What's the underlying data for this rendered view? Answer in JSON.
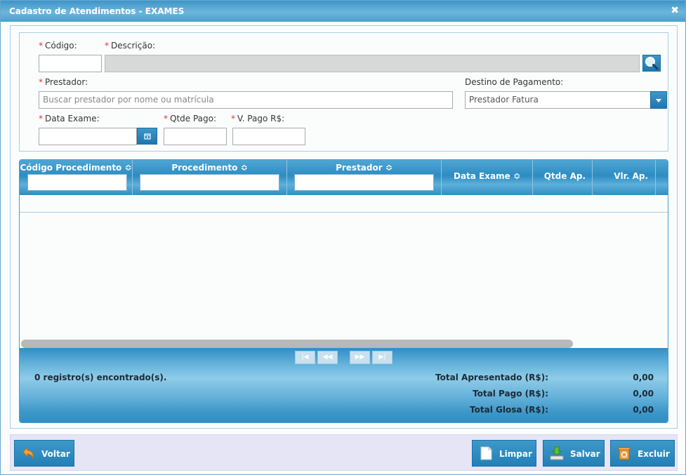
{
  "window": {
    "title": "Cadastro de Atendimentos - EXAMES",
    "close_glyph": "✖"
  },
  "form": {
    "codigo": {
      "label": "Código:",
      "value": ""
    },
    "descricao": {
      "label": "Descrição:",
      "value": ""
    },
    "prestador": {
      "label": "Prestador:",
      "placeholder": "Buscar prestador por nome ou matrícula"
    },
    "destino": {
      "label": "Destino de Pagamento:",
      "selected": "Prestador Fatura"
    },
    "data_exame": {
      "label": "Data Exame:",
      "value": ""
    },
    "qtde_pago": {
      "label": "Qtde Pago:",
      "value": ""
    },
    "v_pago": {
      "label": "V. Pago R$:",
      "value": ""
    },
    "required_mark": "*"
  },
  "grid": {
    "columns": [
      {
        "label": "Código Procedimento",
        "sort_glyph": "≎",
        "filter": true
      },
      {
        "label": "Procedimento",
        "sort_glyph": "≎",
        "filter": true
      },
      {
        "label": "Prestador",
        "sort_glyph": "≎",
        "filter": true
      },
      {
        "label": "Data Exame",
        "sort_glyph": "≎",
        "filter": false
      },
      {
        "label": "Qtde Ap.",
        "sort_glyph": "",
        "filter": false
      },
      {
        "label": "Vlr. Ap.",
        "sort_glyph": "",
        "filter": false
      }
    ],
    "rows": [],
    "pager": {
      "first": "|◀",
      "prev": "◀◀",
      "next": "▶▶",
      "last": "▶|"
    },
    "records_text": "0 registro(s) encontrado(s).",
    "totals": [
      {
        "label": "Total Apresentado (R$):",
        "value": "0,00"
      },
      {
        "label": "Total Pago (R$):",
        "value": "0,00"
      },
      {
        "label": "Total Glosa (R$):",
        "value": "0,00"
      }
    ]
  },
  "actions": {
    "voltar": {
      "label": "Voltar",
      "icon": "undo-arrow-icon"
    },
    "limpar": {
      "label": "Limpar",
      "icon": "blank-page-icon"
    },
    "salvar": {
      "label": "Salvar",
      "icon": "download-tray-icon"
    },
    "excluir": {
      "label": "Excluir",
      "icon": "recycle-bin-icon"
    }
  },
  "colors": {
    "accent": "#2a87bf",
    "required": "#e03030",
    "action_bar": "#e5e5f6"
  }
}
